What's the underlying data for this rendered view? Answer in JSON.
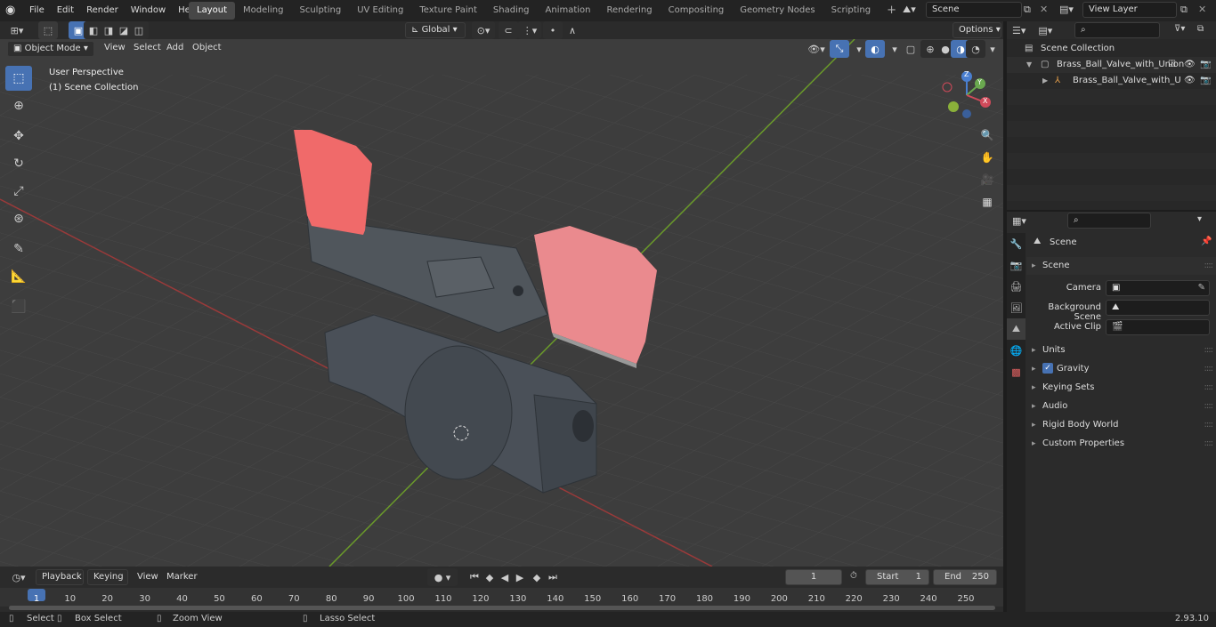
{
  "topbar": {
    "menus": [
      "File",
      "Edit",
      "Render",
      "Window",
      "Help"
    ],
    "workspaces": [
      "Layout",
      "Modeling",
      "Sculpting",
      "UV Editing",
      "Texture Paint",
      "Shading",
      "Animation",
      "Rendering",
      "Compositing",
      "Geometry Nodes",
      "Scripting"
    ],
    "active_workspace": "Layout",
    "scene": "Scene",
    "view_layer": "View Layer"
  },
  "viewport_header": {
    "transform_orientation": "Global",
    "mode": "Object Mode",
    "menus": [
      "View",
      "Select",
      "Add",
      "Object"
    ],
    "options_label": "Options"
  },
  "viewport": {
    "perspective_label": "User Perspective",
    "collection_label": "(1) Scene Collection",
    "gizmo": {
      "x": "X",
      "y": "Y",
      "z": "Z"
    }
  },
  "outliner": {
    "root": "Scene Collection",
    "collection": "Brass_Ball_Valve_with_Union",
    "object": "Brass_Ball_Valve_with_U"
  },
  "properties": {
    "context": "Scene",
    "section": "Scene",
    "fields": [
      {
        "label": "Camera"
      },
      {
        "label": "Background Scene"
      },
      {
        "label": "Active Clip"
      }
    ],
    "panels": [
      "Units",
      "Gravity",
      "Keying Sets",
      "Audio",
      "Rigid Body World",
      "Custom Properties"
    ]
  },
  "timeline": {
    "menus": [
      "Playback",
      "Keying",
      "View",
      "Marker"
    ],
    "current_frame": "1",
    "start_label": "Start",
    "start": "1",
    "end_label": "End",
    "end": "250",
    "ticks": [
      "1",
      "10",
      "20",
      "30",
      "40",
      "50",
      "60",
      "70",
      "80",
      "90",
      "100",
      "110",
      "120",
      "130",
      "140",
      "150",
      "160",
      "170",
      "180",
      "190",
      "200",
      "210",
      "220",
      "230",
      "240",
      "250"
    ]
  },
  "statusbar": {
    "select": "Select",
    "box_select": "Box Select",
    "zoom_view": "Zoom View",
    "lasso_select": "Lasso Select",
    "version": "2.93.10"
  },
  "colors": {
    "accent": "#4772b3",
    "handle_grip": "#f06a6a",
    "valve_body": "#4a5058"
  }
}
